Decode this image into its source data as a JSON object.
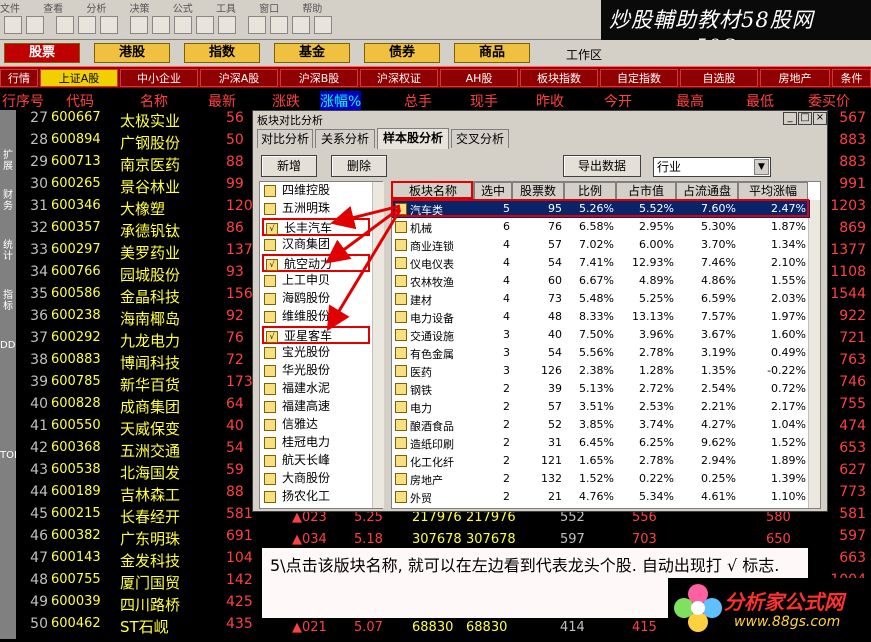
{
  "menu": [
    "文件",
    "查看",
    "分析",
    "决策",
    "公式",
    "工具",
    "窗口",
    "帮助"
  ],
  "banner": {
    "line1": "炒股輔助教材58股网",
    "line2": "www.58Gu.com"
  },
  "market_buttons": [
    "股票",
    "港股",
    "指数",
    "基金",
    "债券",
    "商品"
  ],
  "workspace_label": "工作区",
  "tabs": [
    "行情",
    "上证A股",
    "中小企业",
    "沪深A股",
    "沪深B股",
    "沪深权证",
    "AH股",
    "板块指数",
    "自定指数",
    "自选股",
    "房地产",
    "条件"
  ],
  "columns": [
    "行序号",
    "代码",
    "名称",
    "最新",
    "涨跌",
    "涨幅%",
    "总手",
    "现手",
    "昨收",
    "今开",
    "最高",
    "最低",
    "委买价"
  ],
  "side_tabs": [
    "扩展",
    "财务",
    "统计",
    "指标",
    "DDE",
    "TOP"
  ],
  "stocks": [
    {
      "no": "27",
      "code": "600667",
      "name": "太极实业",
      "v": "56"
    },
    {
      "no": "28",
      "code": "600894",
      "name": "广钢股份",
      "v": "50"
    },
    {
      "no": "29",
      "code": "600713",
      "name": "南京医药",
      "v": "88"
    },
    {
      "no": "30",
      "code": "600265",
      "name": "景谷林业",
      "v": "99"
    },
    {
      "no": "31",
      "code": "600346",
      "name": "大橡塑",
      "v": "120"
    },
    {
      "no": "32",
      "code": "600357",
      "name": "承德钒钛",
      "v": "86"
    },
    {
      "no": "33",
      "code": "600297",
      "name": "美罗药业",
      "v": "137"
    },
    {
      "no": "34",
      "code": "600766",
      "name": "园城股份",
      "v": "93"
    },
    {
      "no": "35",
      "code": "600586",
      "name": "金晶科技",
      "v": "156"
    },
    {
      "no": "36",
      "code": "600238",
      "name": "海南椰岛",
      "v": "92"
    },
    {
      "no": "37",
      "code": "600292",
      "name": "九龙电力",
      "v": "76"
    },
    {
      "no": "38",
      "code": "600883",
      "name": "博闻科技",
      "v": "72"
    },
    {
      "no": "39",
      "code": "600785",
      "name": "新华百货",
      "v": "173"
    },
    {
      "no": "40",
      "code": "600828",
      "name": "成商集团",
      "v": "64"
    },
    {
      "no": "41",
      "code": "600550",
      "name": "天威保变",
      "v": "40"
    },
    {
      "no": "42",
      "code": "600368",
      "name": "五洲交通",
      "v": "54"
    },
    {
      "no": "43",
      "code": "600538",
      "name": "北海国发",
      "v": "59"
    },
    {
      "no": "44",
      "code": "600189",
      "name": "吉林森工",
      "v": "88"
    },
    {
      "no": "45",
      "code": "600215",
      "name": "长春经开",
      "v": "581"
    },
    {
      "no": "46",
      "code": "600382",
      "name": "广东明珠",
      "v": "691"
    },
    {
      "no": "47",
      "code": "600143",
      "name": "金发科技",
      "v": "1040"
    },
    {
      "no": "48",
      "code": "600755",
      "name": "厦门国贸",
      "v": "1428"
    },
    {
      "no": "49",
      "code": "600039",
      "name": "四川路桥",
      "v": "425"
    },
    {
      "no": "50",
      "code": "600462",
      "name": "ST石岘",
      "v": "435"
    }
  ],
  "right_col": [
    "567",
    "883",
    "883",
    "991",
    "1203",
    "869",
    "1377",
    "1108",
    "1544",
    "922",
    "721",
    "763",
    "746",
    "755",
    "474",
    "653",
    "627",
    "773",
    "581",
    "597",
    "663",
    "1004",
    "440",
    "435"
  ],
  "bottom_rows": [
    {
      "a": "▲023",
      "b": "5.25",
      "c": "217976",
      "d": "217976",
      "e": "552",
      "f": "556",
      "g": "580"
    },
    {
      "a": "▲034",
      "b": "5.18",
      "c": "307678",
      "d": "307678",
      "e": "597",
      "f": "703",
      "g": "650"
    },
    {
      "a": "▲021",
      "b": "5.07",
      "c": "68830",
      "d": "68830",
      "e": "414",
      "f": "415",
      "g": "430"
    }
  ],
  "dialog": {
    "title": "板块对比分析",
    "tabs": [
      "对比分析",
      "关系分析",
      "样本股分析",
      "交叉分析"
    ],
    "btn_new": "新增",
    "btn_delete": "删除",
    "btn_export": "导出数据",
    "industry_select": "行业",
    "stock_list": [
      "四维控股",
      "五洲明珠",
      "长丰汽车",
      "汉商集团",
      "航空动力",
      "上工申贝",
      "海鸥股份",
      "维维股份",
      "亚星客车",
      "宝光股份",
      "华光股份",
      "福建水泥",
      "福建高速",
      "信雅达",
      "桂冠电力",
      "航天长峰",
      "大商股份",
      "扬农化工"
    ],
    "grid_headers": [
      "板块名称",
      "选中",
      "股票数",
      "比例",
      "占市值",
      "占流通盘",
      "平均涨幅"
    ],
    "grid_rows": [
      [
        "汽车类",
        "5",
        "95",
        "5.26%",
        "5.52%",
        "7.60%",
        "2.47%"
      ],
      [
        "机械",
        "6",
        "76",
        "6.58%",
        "2.95%",
        "5.30%",
        "1.87%"
      ],
      [
        "商业连锁",
        "4",
        "57",
        "7.02%",
        "6.00%",
        "3.70%",
        "1.34%"
      ],
      [
        "仪电仪表",
        "4",
        "54",
        "7.41%",
        "12.93%",
        "7.46%",
        "2.10%"
      ],
      [
        "农林牧渔",
        "4",
        "60",
        "6.67%",
        "4.89%",
        "4.86%",
        "1.55%"
      ],
      [
        "建材",
        "4",
        "73",
        "5.48%",
        "5.25%",
        "6.59%",
        "2.03%"
      ],
      [
        "电力设备",
        "4",
        "48",
        "8.33%",
        "13.13%",
        "7.57%",
        "1.97%"
      ],
      [
        "交通设施",
        "3",
        "40",
        "7.50%",
        "3.96%",
        "3.67%",
        "1.60%"
      ],
      [
        "有色金属",
        "3",
        "54",
        "5.56%",
        "2.78%",
        "3.19%",
        "0.49%"
      ],
      [
        "医药",
        "3",
        "126",
        "2.38%",
        "1.28%",
        "1.35%",
        "-0.22%"
      ],
      [
        "钢铁",
        "2",
        "39",
        "5.13%",
        "2.72%",
        "2.54%",
        "0.72%"
      ],
      [
        "电力",
        "2",
        "57",
        "3.51%",
        "2.53%",
        "2.21%",
        "2.17%"
      ],
      [
        "酿酒食品",
        "2",
        "52",
        "3.85%",
        "3.74%",
        "4.27%",
        "1.04%"
      ],
      [
        "造纸印刷",
        "2",
        "31",
        "6.45%",
        "6.25%",
        "9.62%",
        "1.52%"
      ],
      [
        "化工化纤",
        "2",
        "121",
        "1.65%",
        "2.78%",
        "2.94%",
        "1.89%"
      ],
      [
        "房地产",
        "2",
        "132",
        "1.52%",
        "0.22%",
        "0.25%",
        "1.39%"
      ],
      [
        "外贸",
        "2",
        "21",
        "4.76%",
        "5.34%",
        "4.61%",
        "1.10%"
      ]
    ]
  },
  "note": "5\\点击该版块名称, 就可以在左边看到代表龙头个股. 自动出现打 √ 标志.",
  "logo": {
    "t1": "分析家公式网",
    "t2": "www.88gs.com"
  }
}
